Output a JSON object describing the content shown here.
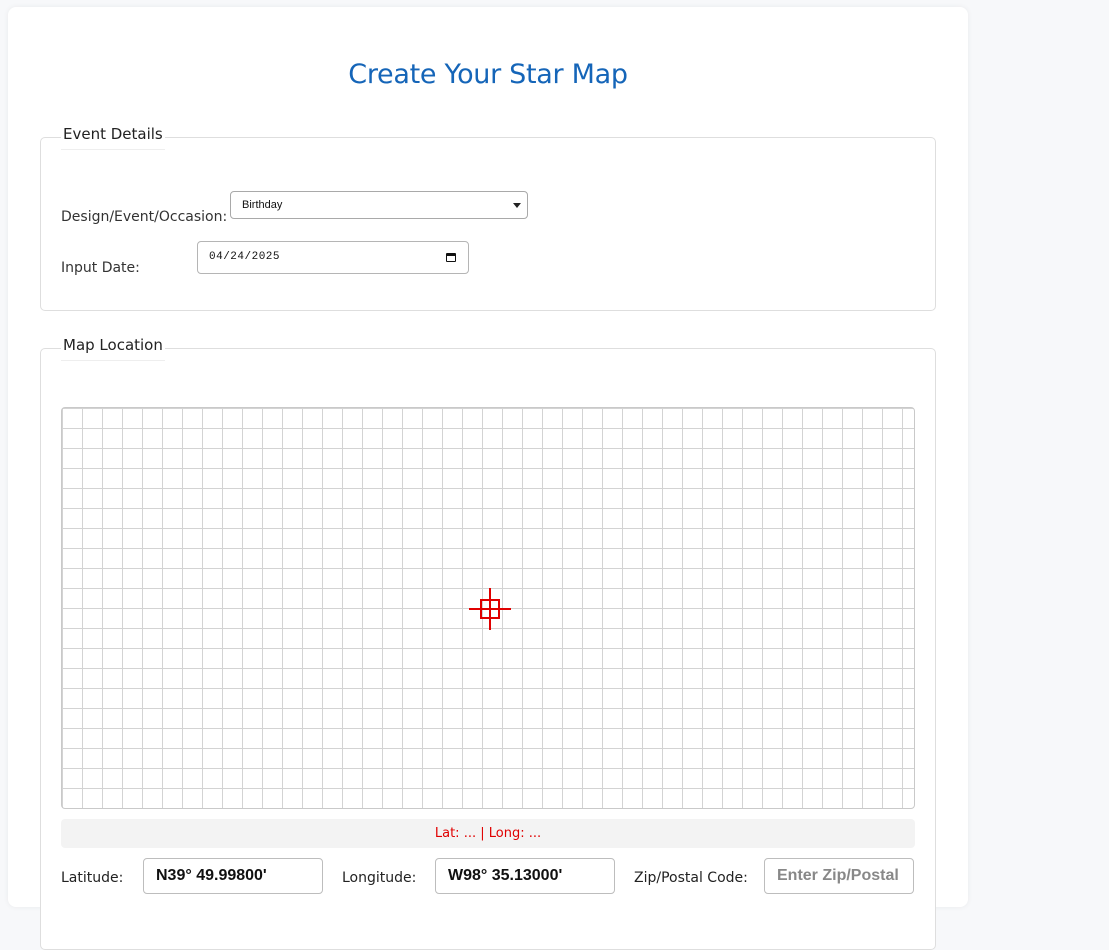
{
  "header": {
    "title": "Create Your Star Map"
  },
  "event_details": {
    "legend": "Event Details",
    "occasion_label": "Design/Event/Occasion:",
    "occasion_value": "Birthday",
    "date_label": "Input Date:",
    "date_value": "04/24/2025"
  },
  "map_location": {
    "legend": "Map Location",
    "coords_readout": "Lat: ... | Long: ...",
    "latitude_label": "Latitude:",
    "latitude_value": "N39° 49.99800'",
    "longitude_label": "Longitude:",
    "longitude_value": "W98° 35.13000'",
    "zip_label": "Zip/Postal Code:",
    "zip_placeholder": "Enter Zip/Postal"
  },
  "colors": {
    "title": "#1565b8",
    "crosshair": "#e00000",
    "readout": "#e00000",
    "grid": "#d3d3d3"
  },
  "icons": {
    "select_caret": "caret-down-icon",
    "calendar": "calendar-icon",
    "map_marker": "crosshair-icon"
  }
}
